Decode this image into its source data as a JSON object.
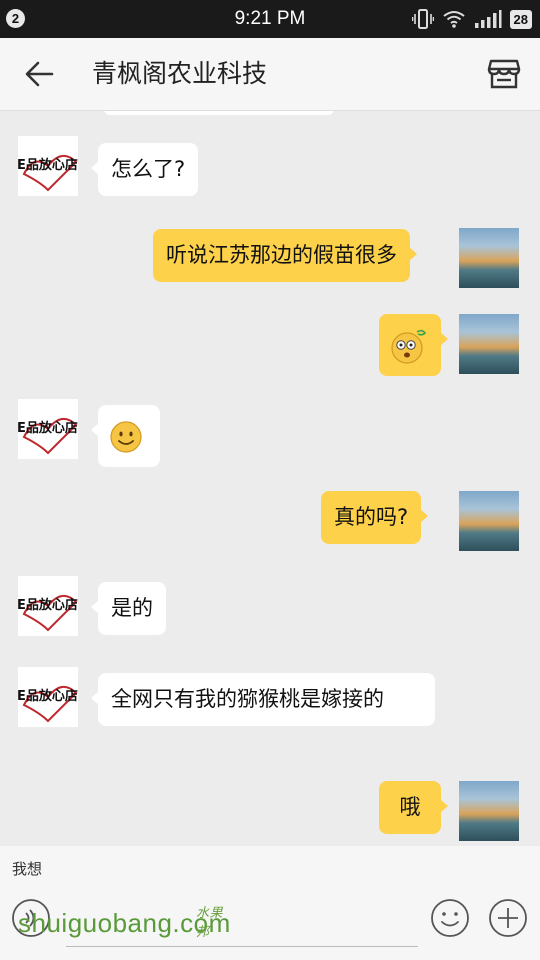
{
  "status_bar": {
    "notification_count": "2",
    "time": "9:21 PM",
    "battery": "28"
  },
  "header": {
    "title": "青枫阁农业科技",
    "back_icon": "arrow-left-icon",
    "store_icon": "store-icon"
  },
  "contact_avatar_text": "E品放心店",
  "messages": [
    {
      "side": "in",
      "text": "怎么了?"
    },
    {
      "side": "out",
      "text": "听说江苏那边的假苗很多"
    },
    {
      "side": "out",
      "emoji": "dizzy-face-emoji"
    },
    {
      "side": "in",
      "emoji": "smile-emoji"
    },
    {
      "side": "out",
      "text": "真的吗?"
    },
    {
      "side": "in",
      "text": "是的"
    },
    {
      "side": "in",
      "text": "全网只有我的猕猴桃是嫁接的"
    },
    {
      "side": "out",
      "text": "哦"
    }
  ],
  "input": {
    "quick_reply": "我想",
    "placeholder": ""
  },
  "watermark": {
    "text": "shuiguobang.com",
    "cn": "水果邦"
  },
  "colors": {
    "outgoing_bubble": "#fdd14a",
    "incoming_bubble": "#ffffff",
    "background": "#ececec"
  }
}
